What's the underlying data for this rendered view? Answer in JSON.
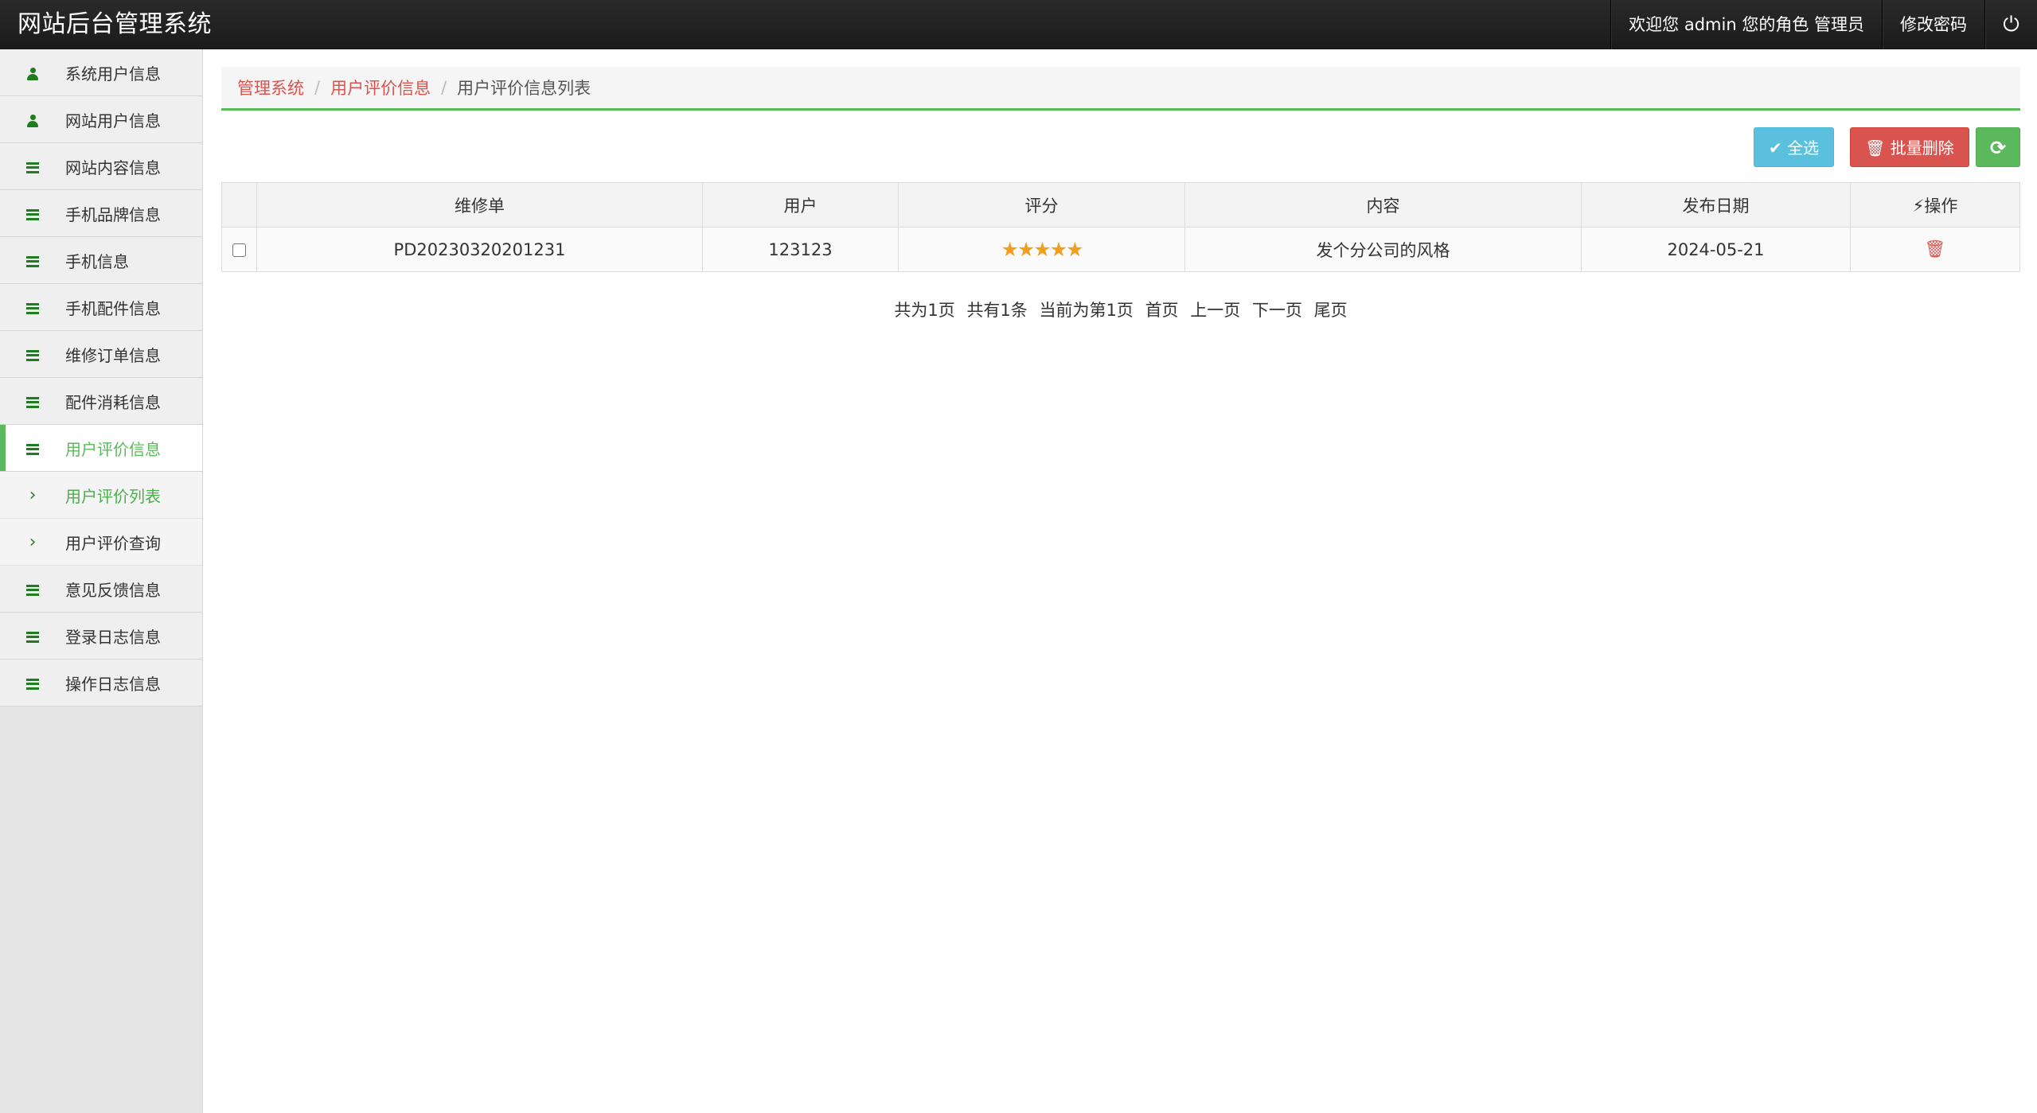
{
  "app": {
    "title": "网站后台管理系统"
  },
  "topnav": {
    "welcome": "欢迎您 admin 您的角色 管理员",
    "change_password": "修改密码",
    "power_icon": "power-icon"
  },
  "sidebar": {
    "items": [
      {
        "label": "系统用户信息",
        "icon": "user-icon"
      },
      {
        "label": "网站用户信息",
        "icon": "user-icon"
      },
      {
        "label": "网站内容信息",
        "icon": "bars-icon"
      },
      {
        "label": "手机品牌信息",
        "icon": "bars-icon"
      },
      {
        "label": "手机信息",
        "icon": "bars-icon"
      },
      {
        "label": "手机配件信息",
        "icon": "bars-icon"
      },
      {
        "label": "维修订单信息",
        "icon": "bars-icon"
      },
      {
        "label": "配件消耗信息",
        "icon": "bars-icon"
      },
      {
        "label": "用户评价信息",
        "icon": "bars-icon",
        "active": true
      },
      {
        "label": "用户评价列表",
        "icon": "chevron-right-icon",
        "sub": true,
        "current": true
      },
      {
        "label": "用户评价查询",
        "icon": "chevron-right-icon",
        "sub": true
      },
      {
        "label": "意见反馈信息",
        "icon": "bars-icon"
      },
      {
        "label": "登录日志信息",
        "icon": "bars-icon"
      },
      {
        "label": "操作日志信息",
        "icon": "bars-icon"
      }
    ]
  },
  "breadcrumb": {
    "items": [
      "管理系统",
      "用户评价信息",
      "用户评价信息列表"
    ],
    "separator": "/"
  },
  "toolbar": {
    "select_all": "全选",
    "batch_delete": "批量删除",
    "refresh_icon": "refresh-icon"
  },
  "table": {
    "columns": [
      "维修单",
      "用户",
      "评分",
      "内容",
      "发布日期",
      "操作"
    ],
    "rows": [
      {
        "order": "PD20230320201231",
        "user": "123123",
        "rating": 5,
        "rating_max": 5,
        "content": "发个分公司的风格",
        "date": "2024-05-21"
      }
    ]
  },
  "pager": {
    "total_pages": "共为1页",
    "total_records": "共有1条",
    "current": "当前为第1页",
    "first": "首页",
    "prev": "上一页",
    "next": "下一页",
    "last": "尾页"
  },
  "colors": {
    "accent": "#5cb85c",
    "danger": "#d9534f",
    "info": "#5bc0de",
    "topbar": "#1e1e1e",
    "icon_green": "#1e7d1e",
    "star": "#f0a01e"
  }
}
